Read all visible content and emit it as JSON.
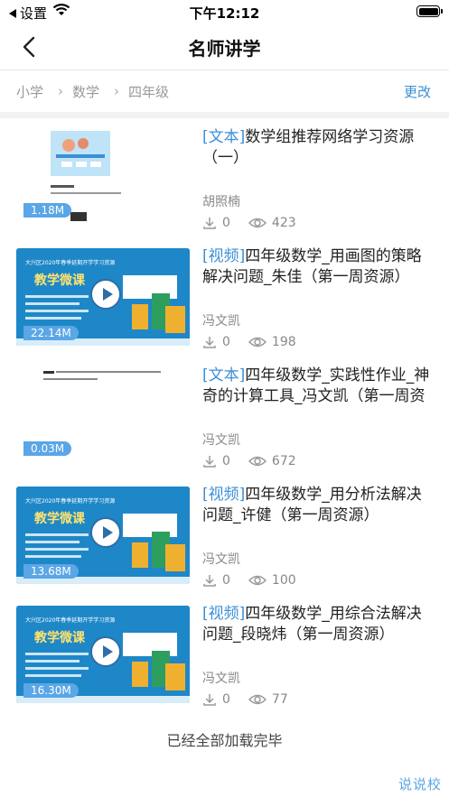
{
  "status": {
    "back_app": "设置",
    "time": "下午12:12"
  },
  "nav": {
    "title": "名师讲学"
  },
  "breadcrumb": {
    "items": [
      "小学",
      "数学",
      "四年级"
    ],
    "change_label": "更改"
  },
  "items": [
    {
      "kind": "doc",
      "tag": "[文本]",
      "title": "数学组推荐网络学习资源（一）",
      "author": "胡照楠",
      "size": "1.18M",
      "downloads": "0",
      "views": "423"
    },
    {
      "kind": "video",
      "tag": "[视频]",
      "title": "四年级数学_用画图的策略解决问题_朱佳（第一周资源）",
      "author": "冯文凯",
      "size": "22.14M",
      "downloads": "0",
      "views": "198"
    },
    {
      "kind": "doc",
      "tag": "[文本]",
      "title": "四年级数学_实践性作业_神奇的计算工具_冯文凯（第一周资源）",
      "author": "冯文凯",
      "size": "0.03M",
      "downloads": "0",
      "views": "672"
    },
    {
      "kind": "video",
      "tag": "[视频]",
      "title": "四年级数学_用分析法解决问题_许健（第一周资源）",
      "author": "冯文凯",
      "size": "13.68M",
      "downloads": "0",
      "views": "100"
    },
    {
      "kind": "video",
      "tag": "[视频]",
      "title": "四年级数学_用综合法解决问题_段晓炜（第一周资源）",
      "author": "冯文凯",
      "size": "16.30M",
      "downloads": "0",
      "views": "77"
    }
  ],
  "thumb_texts": {
    "video_header": "大兴区2020年春季延期开学学习资源",
    "video_title": "教学微课"
  },
  "footer": {
    "message": "已经全部加载完毕"
  },
  "watermark": "说说校",
  "colors": {
    "accent": "#3b8fd6",
    "badge": "#5aa6e6",
    "video_bg": "#1e87c8"
  }
}
